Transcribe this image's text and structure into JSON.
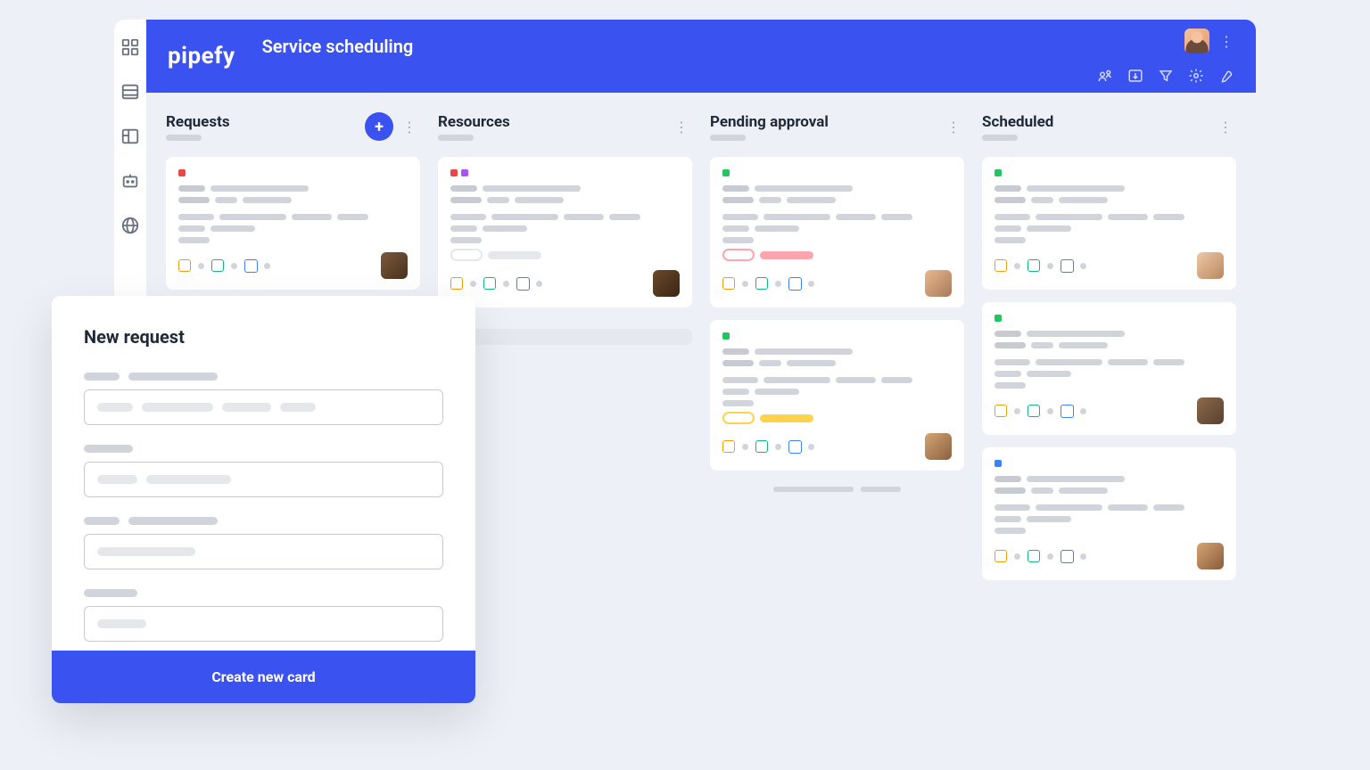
{
  "brand": "pipefy",
  "board_title": "Service scheduling",
  "sidenav": [
    {
      "name": "apps-icon"
    },
    {
      "name": "list-icon"
    },
    {
      "name": "board-icon"
    },
    {
      "name": "bot-icon"
    },
    {
      "name": "globe-icon"
    }
  ],
  "toolbar_icons": [
    {
      "name": "share-icon"
    },
    {
      "name": "import-icon"
    },
    {
      "name": "filter-icon"
    },
    {
      "name": "settings-icon"
    },
    {
      "name": "tools-icon"
    }
  ],
  "columns": [
    {
      "title": "Requests",
      "has_add": true,
      "cards": [
        {
          "tags": [
            "red"
          ],
          "pill": "none",
          "avatar": "av1"
        }
      ]
    },
    {
      "title": "Resources",
      "cards": [
        {
          "tags": [
            "red",
            "purple"
          ],
          "pill": "grey",
          "avatar": "av2"
        }
      ],
      "placeholder": true
    },
    {
      "title": "Pending approval",
      "cards": [
        {
          "tags": [
            "green"
          ],
          "pill": "pink",
          "avatar": "av3"
        },
        {
          "tags": [
            "green"
          ],
          "pill": "amber",
          "avatar": "av4"
        }
      ],
      "footer_bar": true
    },
    {
      "title": "Scheduled",
      "cards": [
        {
          "tags": [
            "green"
          ],
          "pill": "none",
          "avatar": "av5"
        },
        {
          "tags": [
            "green"
          ],
          "pill": "none",
          "avatar": "av6"
        },
        {
          "tags": [
            "blue"
          ],
          "pill": "none",
          "avatar": "av7"
        }
      ]
    }
  ],
  "modal": {
    "title": "New request",
    "submit_label": "Create new card"
  }
}
